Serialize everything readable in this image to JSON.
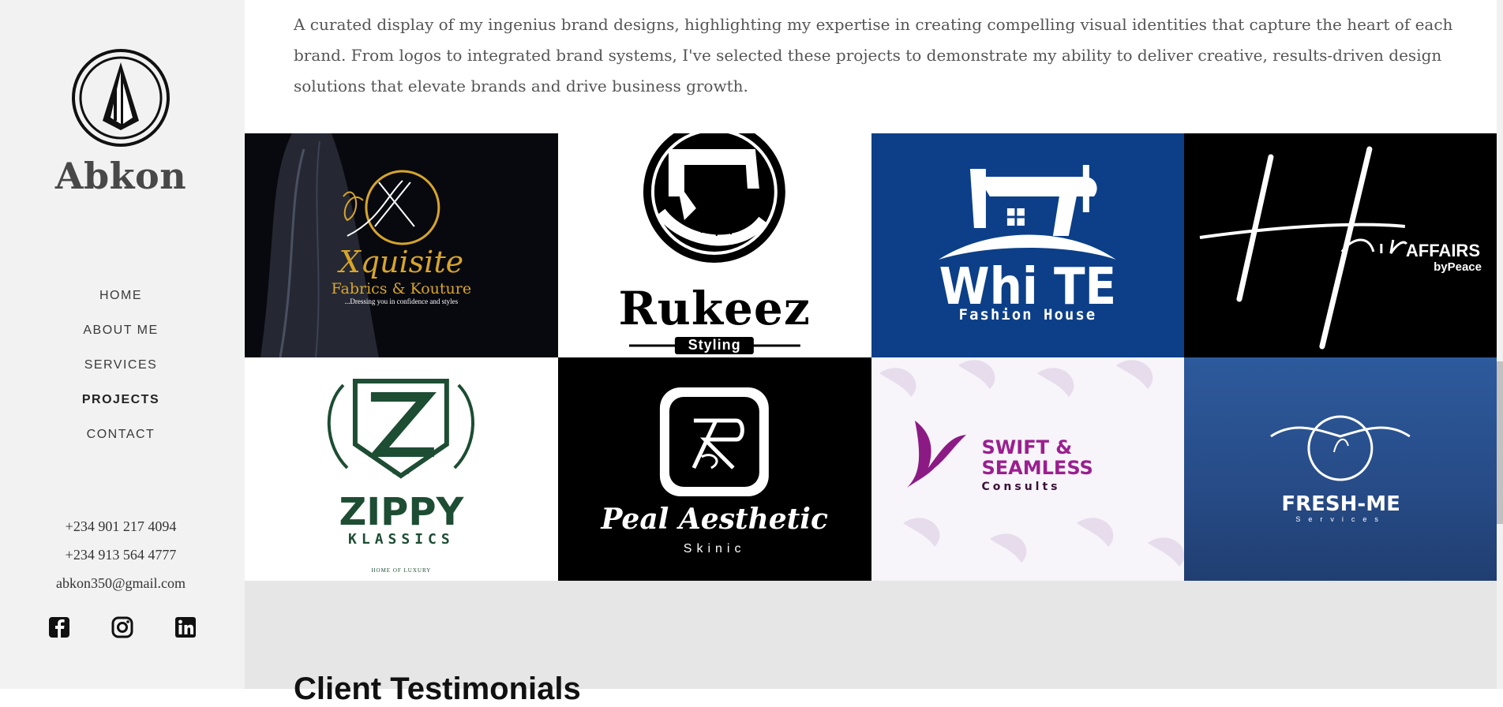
{
  "sidebar": {
    "brand_name": "Abkon",
    "nav": [
      "HOME",
      "ABOUT ME",
      "SERVICES",
      "PROJECTS",
      "CONTACT"
    ],
    "active_nav": "PROJECTS",
    "phone_1": "+234 901 217 4094",
    "phone_2": "+234 913 564 4777",
    "email": "abkon350@gmail.com",
    "socials": [
      "facebook-icon",
      "instagram-icon",
      "linkedin-icon"
    ]
  },
  "main": {
    "intro": "A curated display of my ingenius brand designs, highlighting my expertise in creating compelling visual identities that capture the heart of each brand. From logos to integrated brand systems, I've selected these projects to demonstrate my ability to deliver creative, results-driven design solutions that elevate brands and drive business growth."
  },
  "projects": [
    {
      "name": "Xquisite",
      "sub": "Fabrics & Kouture",
      "tag": "...Dressing you in confidence and styles",
      "bg": "#0b0b12"
    },
    {
      "name": "Rukeez",
      "sub": "Styling",
      "bg": "#ffffff"
    },
    {
      "name": "Whi TE",
      "sub": "Fashion House",
      "bg": "#0c3f88"
    },
    {
      "name": "Hair",
      "sub": "AFFAIRS",
      "tag": "byPeace",
      "bg": "#000000"
    },
    {
      "name": "ZIPPY",
      "sub": "KLASSICS",
      "tag": "HOME OF LUXURY",
      "bg": "#ffffff"
    },
    {
      "name": "Peal Aesthetic",
      "sub": "Skinic",
      "bg": "#000000"
    },
    {
      "name": "SWIFT &",
      "sub": "SEAMLESS",
      "tag": "Consults",
      "bg": "#f7f4fa"
    },
    {
      "name": "FRESH-ME",
      "sub": "Services",
      "bg": "#2d5a9c"
    }
  ],
  "testimonials": {
    "heading": "Client Testimonials"
  },
  "colors": {
    "sidebar_bg": "#f2f2f2",
    "text": "#484848",
    "testimonials_bg": "#e6e6e6",
    "swift_purple": "#9b1f8f",
    "zippy_green": "#1d4d33",
    "xquisite_gold": "#d7a52a"
  }
}
